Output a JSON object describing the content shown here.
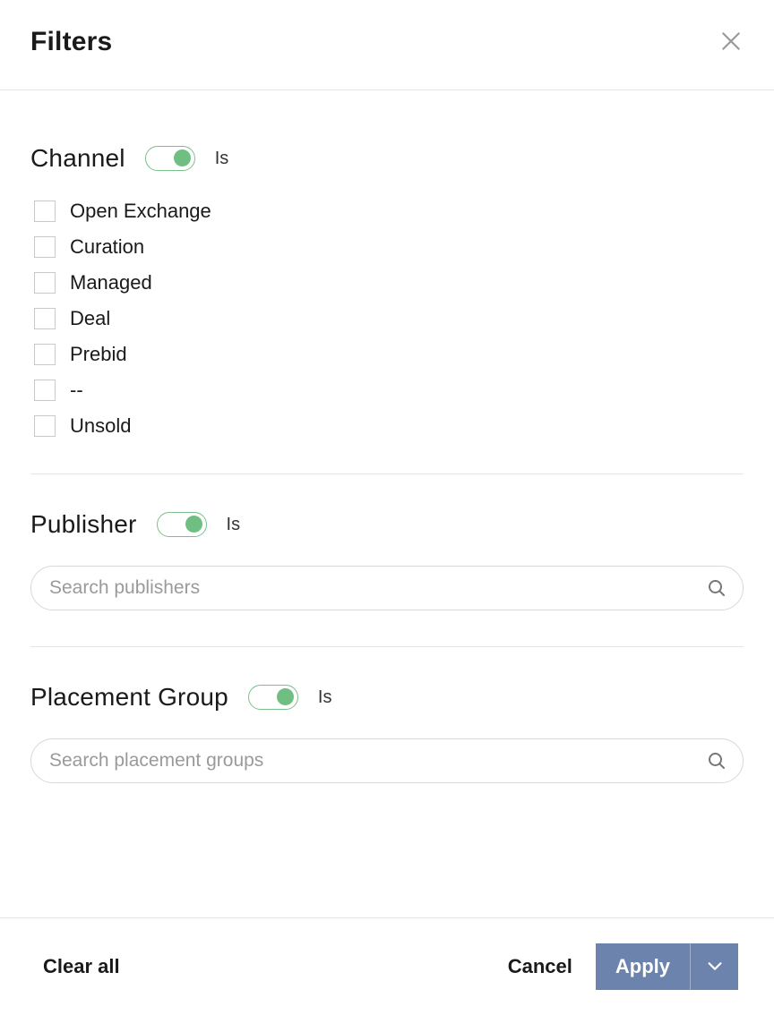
{
  "header": {
    "title": "Filters"
  },
  "sections": {
    "channel": {
      "title": "Channel",
      "toggle_on": true,
      "toggle_label": "Is",
      "options": [
        {
          "label": "Open Exchange",
          "checked": false
        },
        {
          "label": "Curation",
          "checked": false
        },
        {
          "label": "Managed",
          "checked": false
        },
        {
          "label": "Deal",
          "checked": false
        },
        {
          "label": "Prebid",
          "checked": false
        },
        {
          "label": "--",
          "checked": false
        },
        {
          "label": "Unsold",
          "checked": false
        }
      ]
    },
    "publisher": {
      "title": "Publisher",
      "toggle_on": true,
      "toggle_label": "Is",
      "search_placeholder": "Search publishers",
      "search_value": ""
    },
    "placement_group": {
      "title": "Placement Group",
      "toggle_on": true,
      "toggle_label": "Is",
      "search_placeholder": "Search placement groups",
      "search_value": ""
    }
  },
  "footer": {
    "clear_all": "Clear all",
    "cancel": "Cancel",
    "apply": "Apply"
  },
  "colors": {
    "toggle_green": "#6fbf82",
    "primary_button": "#6c84ad"
  }
}
